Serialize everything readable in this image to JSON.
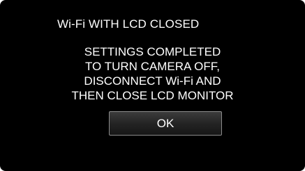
{
  "dialog": {
    "title": "Wi-Fi WITH LCD CLOSED",
    "message_lines": [
      "SETTINGS COMPLETED",
      "TO TURN CAMERA OFF,",
      "DISCONNECT Wi-Fi AND",
      "THEN CLOSE LCD MONITOR"
    ],
    "ok_label": "OK"
  },
  "colors": {
    "screen_background": "#000000",
    "text": "#ffffff",
    "button_border": "#8c8c8c"
  }
}
